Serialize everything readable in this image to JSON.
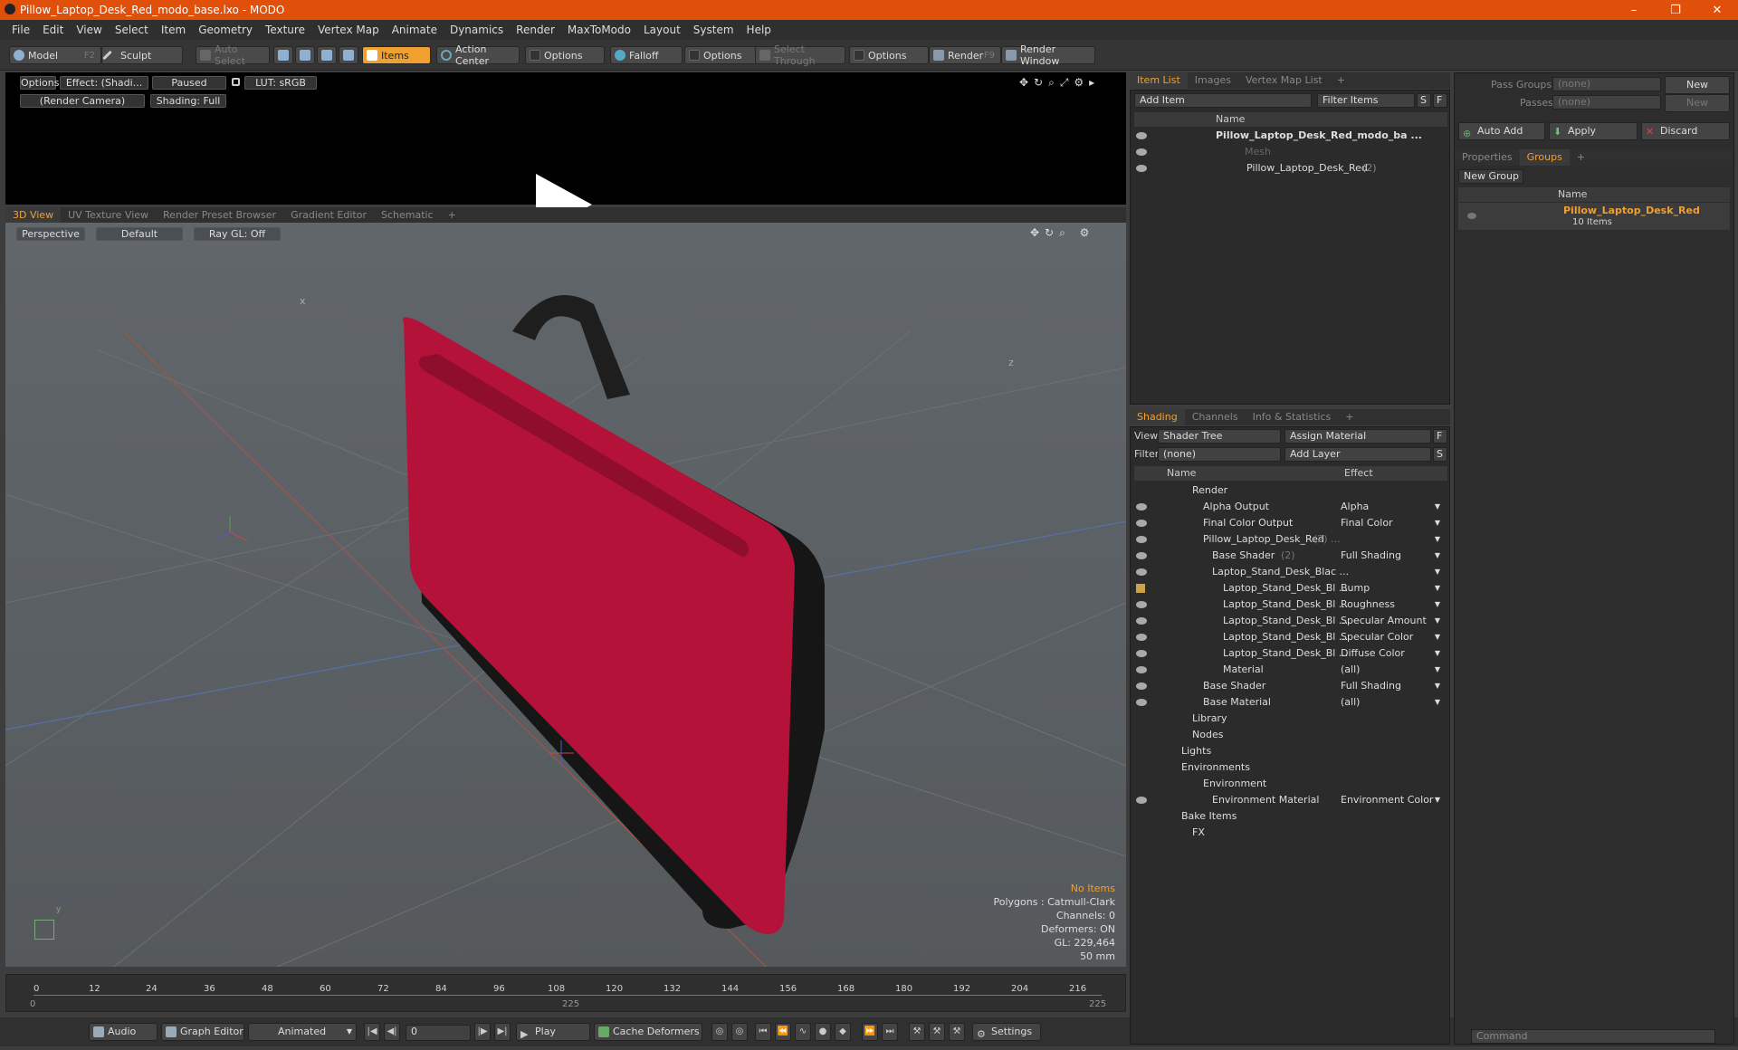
{
  "window": {
    "title": "Pillow_Laptop_Desk_Red_modo_base.lxo - MODO",
    "min": "–",
    "max": "❐",
    "close": "✕"
  },
  "menu": [
    "File",
    "Edit",
    "View",
    "Select",
    "Item",
    "Geometry",
    "Texture",
    "Vertex Map",
    "Animate",
    "Dynamics",
    "Render",
    "MaxToModo",
    "Layout",
    "System",
    "Help"
  ],
  "toolbar": {
    "model": "Model",
    "model_key": "F2",
    "sculpt": "Sculpt",
    "auto_select": "Auto Select",
    "items": "Items",
    "action_center": "Action Center",
    "options": "Options",
    "falloff": "Falloff",
    "select_through": "Select Through",
    "render": "Render",
    "render_key": "F9",
    "render_window": "Render Window"
  },
  "render_view": {
    "options": "Options",
    "effect": "Effect: (Shadi...",
    "paused": "Paused",
    "lut": "LUT: sRGB",
    "camera": "(Render Camera)",
    "shading": "Shading: Full"
  },
  "viewport_tabs": [
    "3D View",
    "UV Texture View",
    "Render Preset Browser",
    "Gradient Editor",
    "Schematic",
    "+"
  ],
  "viewport": {
    "perspective": "Perspective",
    "default": "Default",
    "raygl": "Ray GL: Off",
    "hud": {
      "items": "No Items",
      "polygons": "Polygons : Catmull-Clark",
      "channels": "Channels: 0",
      "deformers": "Deformers: ON",
      "gl": "GL: 229,464",
      "focal": "50 mm"
    },
    "axis_x": "x",
    "axis_z": "z",
    "axis_y": "y"
  },
  "timeline": {
    "ticks": [
      "0",
      "12",
      "24",
      "36",
      "48",
      "60",
      "72",
      "84",
      "96",
      "108",
      "120",
      "132",
      "144",
      "156",
      "168",
      "180",
      "192",
      "204",
      "216"
    ],
    "start": "0",
    "mid": "225",
    "end": "225"
  },
  "bottombar": {
    "audio": "Audio",
    "graph_editor": "Graph Editor",
    "animated": "Animated",
    "frame": "0",
    "play": "Play",
    "cache": "Cache Deformers",
    "settings": "Settings"
  },
  "item_list": {
    "tabs": [
      "Item List",
      "Images",
      "Vertex Map List",
      "+"
    ],
    "add_item": "Add Item",
    "filter": "Filter Items",
    "s": "S",
    "f": "F",
    "col_name": "Name",
    "rows": [
      {
        "label": "Pillow_Laptop_Desk_Red_modo_ba ...",
        "suffix": ""
      },
      {
        "label": "Mesh",
        "suffix": ""
      },
      {
        "label": "Pillow_Laptop_Desk_Red",
        "suffix": "(2)"
      }
    ]
  },
  "shading": {
    "tabs": [
      "Shading",
      "Channels",
      "Info & Statistics",
      "+"
    ],
    "view_label": "View",
    "view": "Shader Tree",
    "assign": "Assign Material",
    "f": "F",
    "filter_label": "Filter",
    "filter": "(none)",
    "add_layer": "Add Layer",
    "s": "S",
    "col_name": "Name",
    "col_effect": "Effect",
    "rows": [
      {
        "name": "Render",
        "suffix": "",
        "effect": ""
      },
      {
        "name": "Alpha Output",
        "suffix": "",
        "effect": "Alpha"
      },
      {
        "name": "Final Color Output",
        "suffix": "",
        "effect": "Final Color"
      },
      {
        "name": "Pillow_Laptop_Desk_Red",
        "suffix": "(2) ...",
        "effect": ""
      },
      {
        "name": "Base Shader",
        "suffix": "(2)",
        "effect": "Full Shading"
      },
      {
        "name": "Laptop_Stand_Desk_Blac ...",
        "suffix": "",
        "effect": ""
      },
      {
        "name": "Laptop_Stand_Desk_Bl ...",
        "suffix": "",
        "effect": "Bump"
      },
      {
        "name": "Laptop_Stand_Desk_Bl ...",
        "suffix": "",
        "effect": "Roughness"
      },
      {
        "name": "Laptop_Stand_Desk_Bl ...",
        "suffix": "",
        "effect": "Specular Amount"
      },
      {
        "name": "Laptop_Stand_Desk_Bl ...",
        "suffix": "",
        "effect": "Specular Color"
      },
      {
        "name": "Laptop_Stand_Desk_Bl ...",
        "suffix": "",
        "effect": "Diffuse Color"
      },
      {
        "name": "Material",
        "suffix": "",
        "effect": "(all)"
      },
      {
        "name": "Base Shader",
        "suffix": "",
        "effect": "Full Shading"
      },
      {
        "name": "Base Material",
        "suffix": "",
        "effect": "(all)"
      },
      {
        "name": "Library",
        "suffix": "",
        "effect": ""
      },
      {
        "name": "Nodes",
        "suffix": "",
        "effect": ""
      },
      {
        "name": "Lights",
        "suffix": "",
        "effect": ""
      },
      {
        "name": "Environments",
        "suffix": "",
        "effect": ""
      },
      {
        "name": "Environment",
        "suffix": "",
        "effect": ""
      },
      {
        "name": "Environment Material",
        "suffix": "",
        "effect": "Environment Color"
      },
      {
        "name": "Bake Items",
        "suffix": "",
        "effect": ""
      },
      {
        "name": "FX",
        "suffix": "",
        "effect": ""
      }
    ]
  },
  "groups": {
    "pass_groups_label": "Pass Groups",
    "pass_groups": "(none)",
    "passes_label": "Passes",
    "passes": "(none)",
    "new": "New",
    "auto_add": "Auto Add",
    "apply": "Apply",
    "discard": "Discard",
    "tabs": [
      "Properties",
      "Groups",
      "+"
    ],
    "new_group": "New Group",
    "col_name": "Name",
    "group_name": "Pillow_Laptop_Desk_Red",
    "group_count": "10 Items",
    "command_placeholder": "Command"
  },
  "colors": {
    "accent": "#f0a030",
    "title": "#e0500b",
    "pillow": "#b5123a"
  }
}
